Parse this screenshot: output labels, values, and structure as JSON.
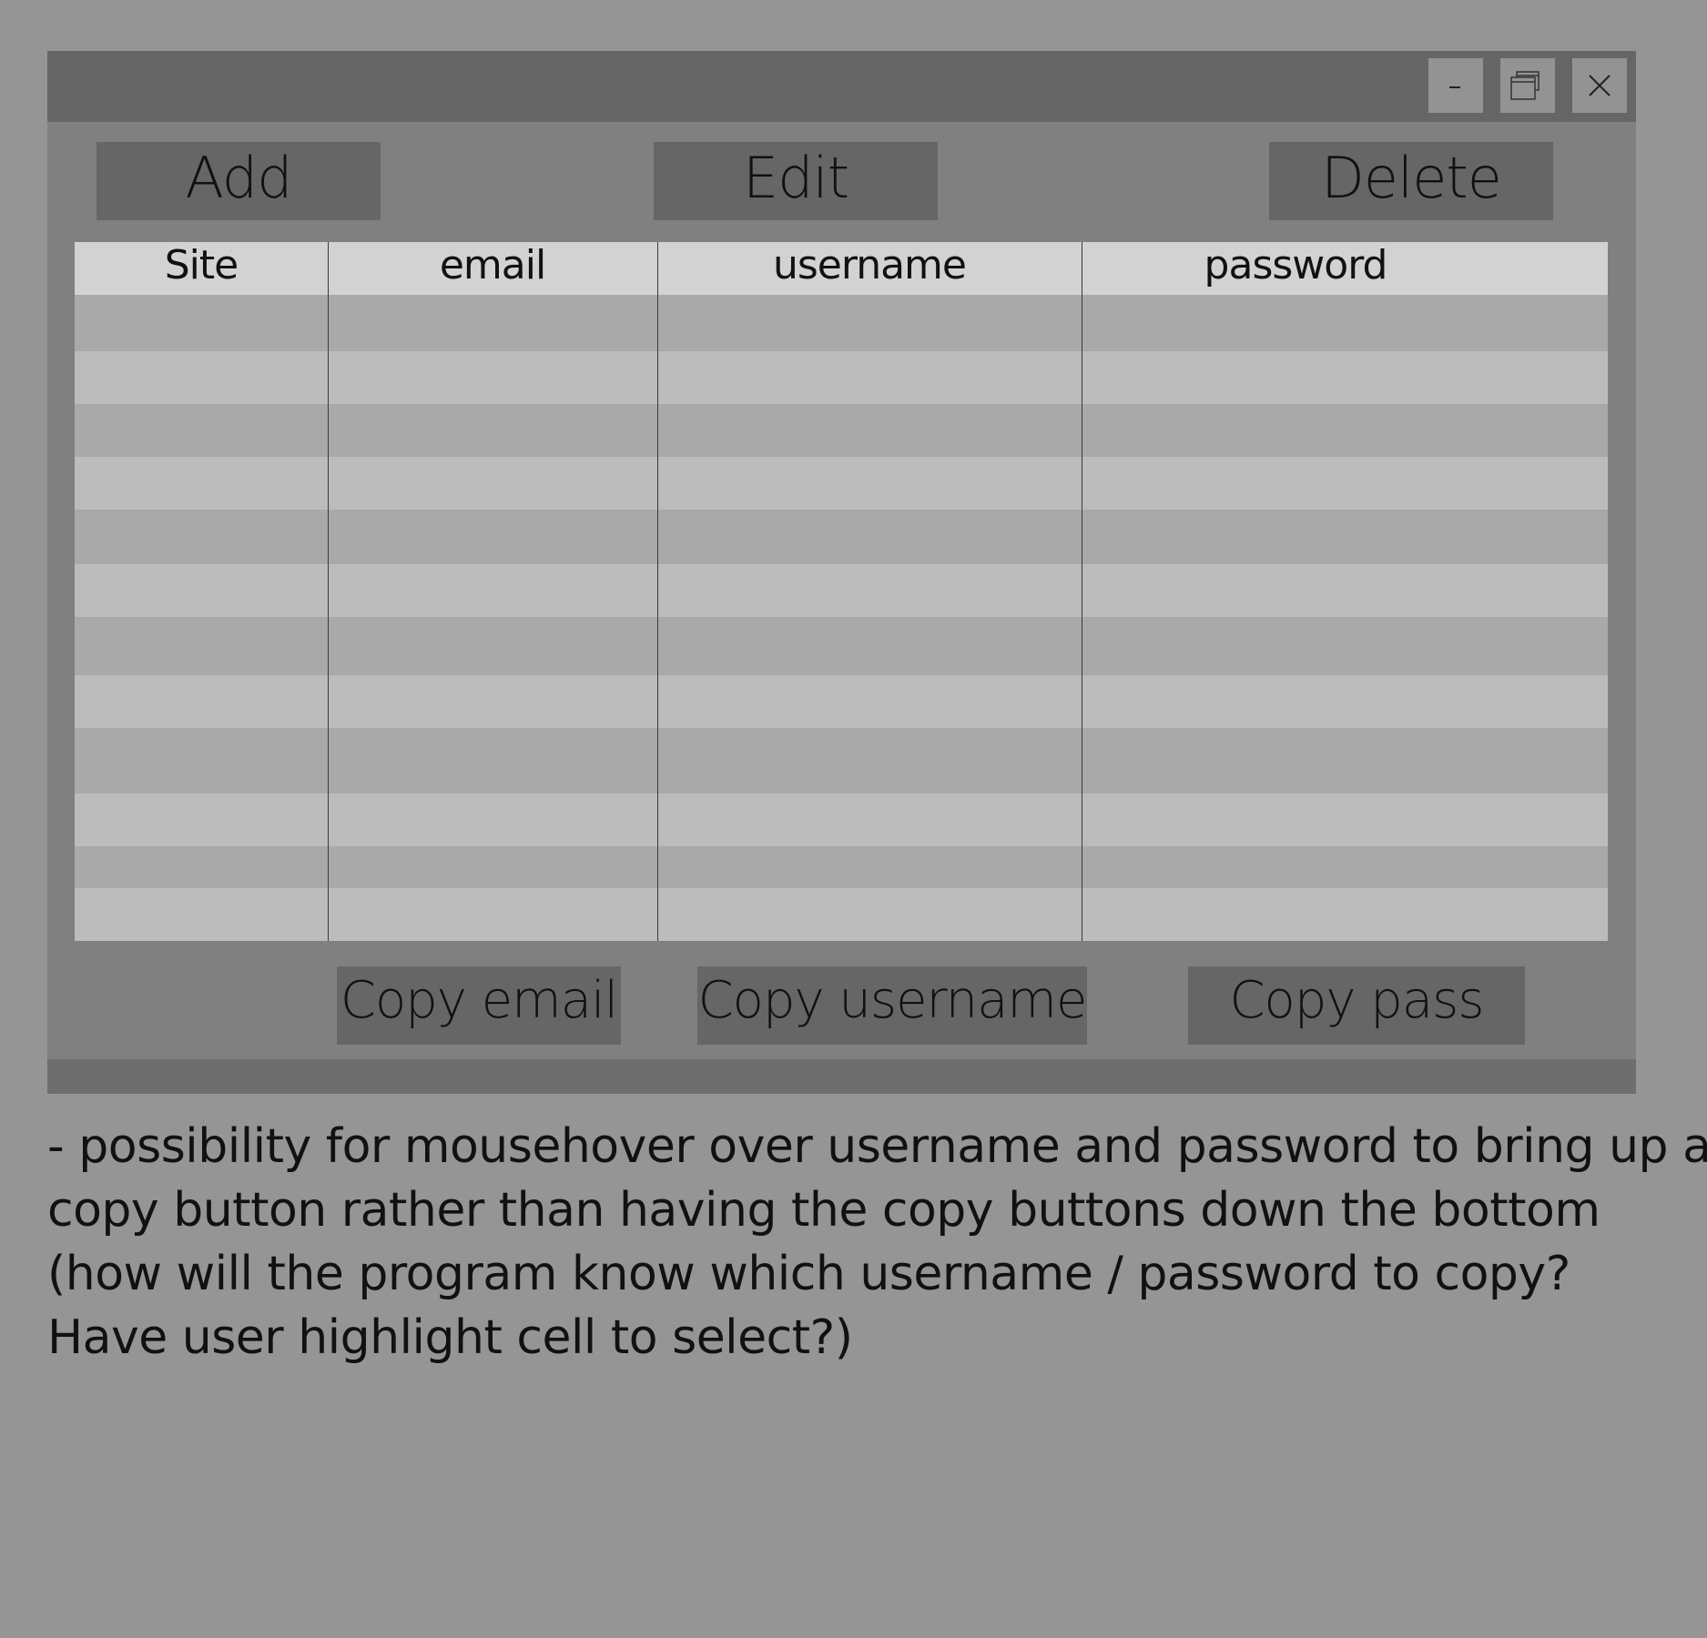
{
  "window": {
    "controls": {
      "minimize_label": "-",
      "maximize_icon": "restore-windows-icon",
      "close_icon": "close-x-icon"
    }
  },
  "toolbar": {
    "add_label": "Add",
    "edit_label": "Edit",
    "delete_label": "Delete"
  },
  "table": {
    "columns": [
      "Site",
      "email",
      "username",
      "password"
    ],
    "rows": [
      [
        "",
        "",
        "",
        ""
      ],
      [
        "",
        "",
        "",
        ""
      ],
      [
        "",
        "",
        "",
        ""
      ],
      [
        "",
        "",
        "",
        ""
      ],
      [
        "",
        "",
        "",
        ""
      ],
      [
        "",
        "",
        "",
        ""
      ],
      [
        "",
        "",
        "",
        ""
      ],
      [
        "",
        "",
        "",
        ""
      ],
      [
        "",
        "",
        "",
        ""
      ],
      [
        "",
        "",
        "",
        ""
      ],
      [
        "",
        "",
        "",
        ""
      ],
      [
        "",
        "",
        "",
        ""
      ]
    ]
  },
  "copy_bar": {
    "copy_email_label": "Copy email",
    "copy_username_label": "Copy username",
    "copy_pass_label": "Copy pass"
  },
  "note": {
    "lines": [
      "- possibility for mousehover over username and password to bring up a",
      "copy button rather than having the copy buttons down the bottom",
      "(how will the program know which username / password to copy?",
      "Have user highlight cell to select?)"
    ]
  },
  "colors": {
    "background": "#959595",
    "window": "#808080",
    "titlebar": "#666666",
    "button": "#666666",
    "header_row": "#d2d2d2",
    "row_dark": "#a9a9a9",
    "row_light": "#bcbcbc"
  }
}
